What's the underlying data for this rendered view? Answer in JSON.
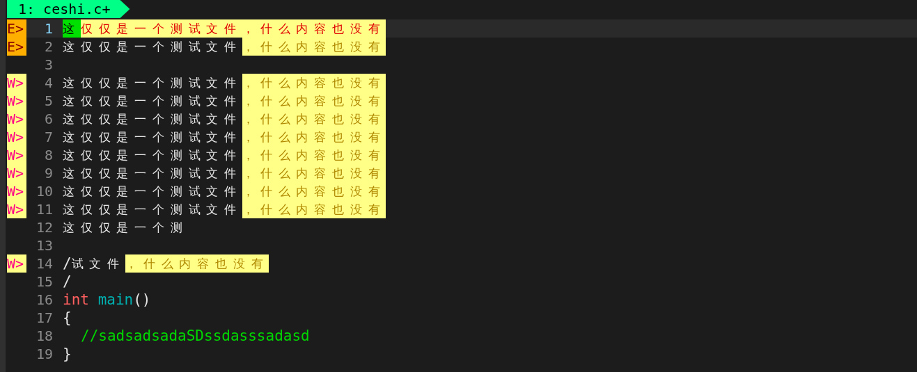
{
  "tabline": {
    "tabs": [
      {
        "label": "1: ceshi.c+",
        "selected": true
      }
    ]
  },
  "lines": [
    {
      "number": "1",
      "sign": {
        "text": "E>",
        "kind": "error"
      },
      "current": true,
      "segments": [
        {
          "text": "这",
          "kind": "cursor"
        },
        {
          "text": "仅仅是一个测试文件，什么内容也没有",
          "kind": "match"
        }
      ]
    },
    {
      "number": "2",
      "sign": {
        "text": "E>",
        "kind": "error"
      },
      "current": false,
      "segments": [
        {
          "text": "这仅仅是一个测试文件",
          "kind": "plain"
        },
        {
          "text": "，什么内容也没有",
          "kind": "match"
        }
      ]
    },
    {
      "number": "3",
      "current": false
    },
    {
      "number": "4",
      "sign": {
        "text": "W>",
        "kind": "warning"
      },
      "current": false,
      "segments": [
        {
          "text": "这仅仅是一个测试文件",
          "kind": "plain"
        },
        {
          "text": "，什么内容也没有",
          "kind": "match"
        }
      ]
    },
    {
      "number": "5",
      "sign": {
        "text": "W>",
        "kind": "warning"
      },
      "current": false,
      "segments": [
        {
          "text": "这仅仅是一个测试文件",
          "kind": "plain"
        },
        {
          "text": "，什么内容也没有",
          "kind": "match"
        }
      ]
    },
    {
      "number": "6",
      "sign": {
        "text": "W>",
        "kind": "warning"
      },
      "current": false,
      "segments": [
        {
          "text": "这仅仅是一个测试文件",
          "kind": "plain"
        },
        {
          "text": "，什么内容也没有",
          "kind": "match"
        }
      ]
    },
    {
      "number": "7",
      "sign": {
        "text": "W>",
        "kind": "warning"
      },
      "current": false,
      "segments": [
        {
          "text": "这仅仅是一个测试文件",
          "kind": "plain"
        },
        {
          "text": "，什么内容也没有",
          "kind": "match"
        }
      ]
    },
    {
      "number": "8",
      "sign": {
        "text": "W>",
        "kind": "warning"
      },
      "current": false,
      "segments": [
        {
          "text": "这仅仅是一个测试文件",
          "kind": "plain"
        },
        {
          "text": "，什么内容也没有",
          "kind": "match"
        }
      ]
    },
    {
      "number": "9",
      "sign": {
        "text": "W>",
        "kind": "warning"
      },
      "current": false,
      "segments": [
        {
          "text": "这仅仅是一个测试文件",
          "kind": "plain"
        },
        {
          "text": "，什么内容也没有",
          "kind": "match"
        }
      ]
    },
    {
      "number": "10",
      "sign": {
        "text": "W>",
        "kind": "warning"
      },
      "current": false,
      "segments": [
        {
          "text": "这仅仅是一个测试文件",
          "kind": "plain"
        },
        {
          "text": "，什么内容也没有",
          "kind": "match"
        }
      ]
    },
    {
      "number": "11",
      "sign": {
        "text": "W>",
        "kind": "warning"
      },
      "current": false,
      "segments": [
        {
          "text": "这仅仅是一个测试文件",
          "kind": "plain"
        },
        {
          "text": "，什么内容也没有",
          "kind": "match"
        }
      ]
    },
    {
      "number": "12",
      "current": false,
      "segments": [
        {
          "text": "这仅仅是一个测",
          "kind": "plain"
        }
      ]
    },
    {
      "number": "13",
      "current": false
    },
    {
      "number": "14",
      "sign": {
        "text": "W>",
        "kind": "warning"
      },
      "current": false,
      "segments": [
        {
          "text": "/",
          "kind": "plain"
        },
        {
          "text": "试文件",
          "kind": "plain"
        },
        {
          "text": "，什么内容也没有",
          "kind": "match"
        }
      ]
    },
    {
      "number": "15",
      "current": false,
      "segments": [
        {
          "text": "/",
          "kind": "plain"
        }
      ]
    },
    {
      "number": "16",
      "current": false,
      "segments": [
        {
          "text": "int",
          "kind": "keyword"
        },
        {
          "text": "main",
          "kind": "function"
        },
        {
          "text": "()",
          "kind": "plain"
        }
      ]
    },
    {
      "number": "17",
      "current": false,
      "segments": [
        {
          "text": "{",
          "kind": "plain"
        }
      ]
    },
    {
      "number": "18",
      "current": false,
      "indented": true,
      "segments": [
        {
          "text": "//sadsadsadaSDssdasssadasd",
          "kind": "comment"
        }
      ]
    },
    {
      "number": "19",
      "current": false,
      "segments": [
        {
          "text": "}",
          "kind": "plain"
        }
      ]
    }
  ]
}
